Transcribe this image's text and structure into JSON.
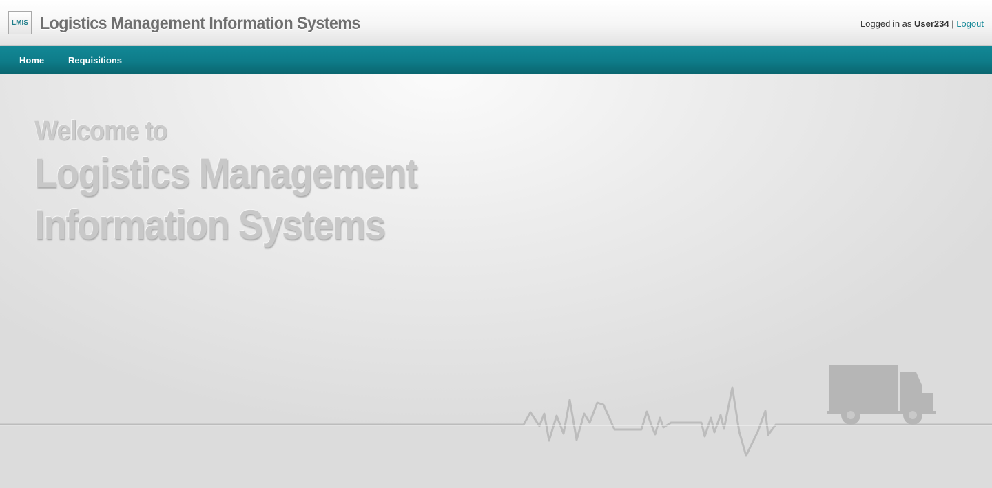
{
  "header": {
    "logo_text": "LMIS",
    "title": "Logistics Management Information Systems",
    "user": {
      "logged_in_prefix": "Logged in as ",
      "username": "User234",
      "separator": " | ",
      "logout_label": "Logout"
    }
  },
  "nav": {
    "items": [
      {
        "label": "Home"
      },
      {
        "label": "Requisitions"
      }
    ]
  },
  "hero": {
    "welcome": "Welcome to",
    "title_line1": "Logistics Management",
    "title_line2": "Information Systems"
  },
  "icons": {
    "truck": "truck-icon",
    "heartbeat": "heartbeat-line"
  },
  "colors": {
    "accent": "#0e7c89",
    "link": "#1a8a99",
    "title_gray": "#6f6f6f",
    "hero_text": "#c8c8c8"
  }
}
